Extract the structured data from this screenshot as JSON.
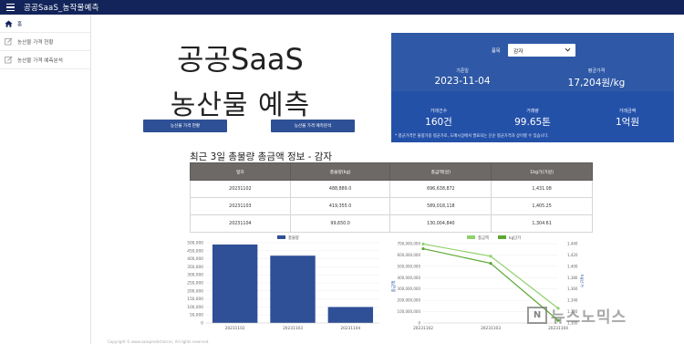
{
  "app": {
    "title": "공공SaaS_농작물예측"
  },
  "sidebar": {
    "items": [
      {
        "label": "홈",
        "icon": "home-icon"
      },
      {
        "label": "농산물 가격 현황",
        "icon": "edit-icon"
      },
      {
        "label": "농산물 가격 예측분석",
        "icon": "edit-icon"
      }
    ]
  },
  "hero": {
    "title_line1": "공공SaaS",
    "title_line2": "농산물 예측",
    "btn_price_status": "농산물 가격 현황",
    "btn_price_forecast": "농산물 가격 예측분석"
  },
  "panel": {
    "select_label": "품목",
    "select_value": "감자",
    "base_date_label": "기준일",
    "base_date_value": "2023-11-04",
    "avg_price_label": "평균가격",
    "avg_price_value": "17,204원/kg",
    "trade_count_label": "거래건수",
    "trade_count_value": "160건",
    "trade_volume_label": "거래량",
    "trade_volume_value": "99.65톤",
    "trade_amount_label": "거래금액",
    "trade_amount_value": "1억원",
    "note": "* 평균가격은 물량가중 평균가로, 도매시장에서 발표되는 단순 평균가격과 상이할 수 있습니다."
  },
  "table": {
    "title": "최근 3일 총물량 총금액 정보 - 감자",
    "headers": [
      "일자",
      "총물량(kg)",
      "총금액(원)",
      "1kg가(가원)"
    ],
    "rows": [
      [
        "20231102",
        "488,889.0",
        "696,638,872",
        "1,431.08"
      ],
      [
        "20231103",
        "419,355.0",
        "589,018,118",
        "1,405.25"
      ],
      [
        "20231104",
        "99,650.0",
        "130,004,840",
        "1,304.61"
      ]
    ]
  },
  "chart_data": [
    {
      "type": "bar",
      "categories": [
        "20231102",
        "20231103",
        "20231104"
      ],
      "series": [
        {
          "name": "총물량",
          "values": [
            488889,
            419355,
            99650
          ],
          "color": "#2f4f97"
        }
      ],
      "ylim": [
        0,
        500000
      ],
      "yticks": [
        "0",
        "50,000",
        "100,000",
        "150,000",
        "200,000",
        "250,000",
        "300,000",
        "350,000",
        "400,000",
        "450,000",
        "500,000"
      ]
    },
    {
      "type": "line",
      "categories": [
        "20231102",
        "20231103",
        "20231104"
      ],
      "series": [
        {
          "name": "총금액",
          "values": [
            696638872,
            589018118,
            130004840
          ],
          "color": "#8fd16a",
          "axis": "left"
        },
        {
          "name": "kg단가",
          "values": [
            1431.08,
            1405.25,
            1304.61
          ],
          "color": "#5aa832",
          "axis": "right"
        }
      ],
      "ylabel": "총금액",
      "y2label": "kg단가",
      "ylim": [
        0,
        700000000
      ],
      "y2lim": [
        1300,
        1440
      ],
      "yticks": [
        "0",
        "100,000,000",
        "200,000,000",
        "300,000,000",
        "400,000,000",
        "500,000,000",
        "600,000,000",
        "700,000,000"
      ],
      "y2ticks": [
        "1,300",
        "1,320",
        "1,340",
        "1,360",
        "1,380",
        "1,400",
        "1,420",
        "1,440"
      ]
    }
  ],
  "footer": {
    "text": "Copyright © www.saasprediction.kr, All rights reserved."
  },
  "watermark": {
    "logo": "N",
    "text": "뉴스노믹스"
  }
}
